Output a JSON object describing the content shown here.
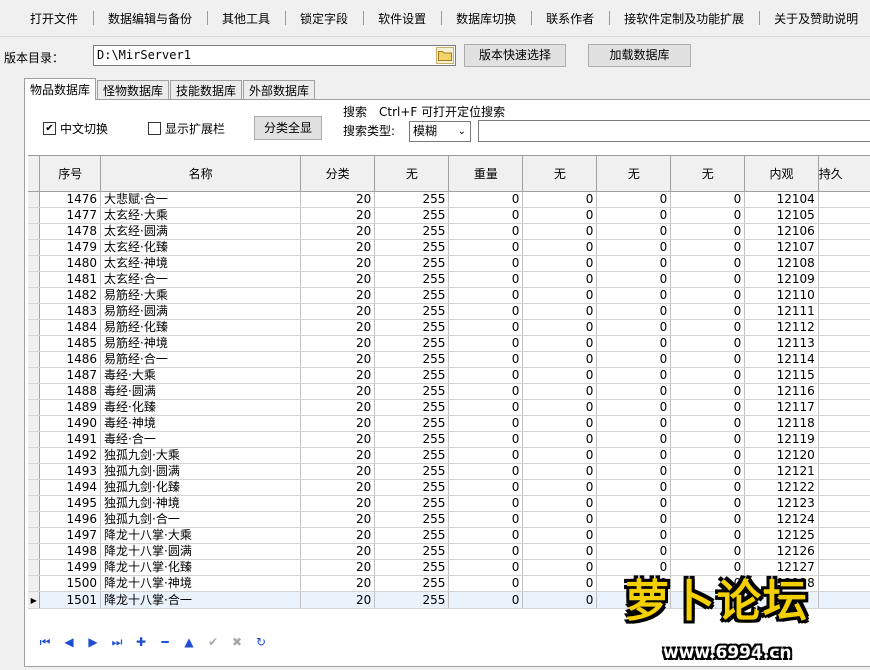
{
  "menu": [
    "打开文件",
    "数据编辑与备份",
    "其他工具",
    "锁定字段",
    "软件设置",
    "数据库切换",
    "联系作者",
    "接软件定制及功能扩展",
    "关于及赞助说明"
  ],
  "version": {
    "label": "版本目录：",
    "path": "D:\\MirServer1",
    "quick_select": "版本快速选择",
    "load_db": "加载数据库"
  },
  "tabs": [
    "物品数据库",
    "怪物数据库",
    "技能数据库",
    "外部数据库"
  ],
  "options": {
    "chinese_switch": "中文切换",
    "chinese_switch_checked": true,
    "show_ext": "显示扩展栏",
    "show_ext_checked": false,
    "show_all_categories": "分类全显"
  },
  "search": {
    "hint": "搜索　Ctrl+F 可打开定位搜索",
    "type_label": "搜索类型:",
    "type_value": "模糊",
    "query": ""
  },
  "grid": {
    "columns": [
      "序号",
      "名称",
      "分类",
      "无",
      "重量",
      "无",
      "无",
      "无",
      "内观",
      "持久"
    ],
    "selected_row": 25,
    "rows": [
      [
        "1476",
        "大悲赋·合一",
        "20",
        "255",
        "0",
        "0",
        "0",
        "0",
        "12104"
      ],
      [
        "1477",
        "太玄经·大乘",
        "20",
        "255",
        "0",
        "0",
        "0",
        "0",
        "12105"
      ],
      [
        "1478",
        "太玄经·圆满",
        "20",
        "255",
        "0",
        "0",
        "0",
        "0",
        "12106"
      ],
      [
        "1479",
        "太玄经·化臻",
        "20",
        "255",
        "0",
        "0",
        "0",
        "0",
        "12107"
      ],
      [
        "1480",
        "太玄经·神境",
        "20",
        "255",
        "0",
        "0",
        "0",
        "0",
        "12108"
      ],
      [
        "1481",
        "太玄经·合一",
        "20",
        "255",
        "0",
        "0",
        "0",
        "0",
        "12109"
      ],
      [
        "1482",
        "易筋经·大乘",
        "20",
        "255",
        "0",
        "0",
        "0",
        "0",
        "12110"
      ],
      [
        "1483",
        "易筋经·圆满",
        "20",
        "255",
        "0",
        "0",
        "0",
        "0",
        "12111"
      ],
      [
        "1484",
        "易筋经·化臻",
        "20",
        "255",
        "0",
        "0",
        "0",
        "0",
        "12112"
      ],
      [
        "1485",
        "易筋经·神境",
        "20",
        "255",
        "0",
        "0",
        "0",
        "0",
        "12113"
      ],
      [
        "1486",
        "易筋经·合一",
        "20",
        "255",
        "0",
        "0",
        "0",
        "0",
        "12114"
      ],
      [
        "1487",
        "毒经·大乘",
        "20",
        "255",
        "0",
        "0",
        "0",
        "0",
        "12115"
      ],
      [
        "1488",
        "毒经·圆满",
        "20",
        "255",
        "0",
        "0",
        "0",
        "0",
        "12116"
      ],
      [
        "1489",
        "毒经·化臻",
        "20",
        "255",
        "0",
        "0",
        "0",
        "0",
        "12117"
      ],
      [
        "1490",
        "毒经·神境",
        "20",
        "255",
        "0",
        "0",
        "0",
        "0",
        "12118"
      ],
      [
        "1491",
        "毒经·合一",
        "20",
        "255",
        "0",
        "0",
        "0",
        "0",
        "12119"
      ],
      [
        "1492",
        "独孤九剑·大乘",
        "20",
        "255",
        "0",
        "0",
        "0",
        "0",
        "12120"
      ],
      [
        "1493",
        "独孤九剑·圆满",
        "20",
        "255",
        "0",
        "0",
        "0",
        "0",
        "12121"
      ],
      [
        "1494",
        "独孤九剑·化臻",
        "20",
        "255",
        "0",
        "0",
        "0",
        "0",
        "12122"
      ],
      [
        "1495",
        "独孤九剑·神境",
        "20",
        "255",
        "0",
        "0",
        "0",
        "0",
        "12123"
      ],
      [
        "1496",
        "独孤九剑·合一",
        "20",
        "255",
        "0",
        "0",
        "0",
        "0",
        "12124"
      ],
      [
        "1497",
        "降龙十八掌·大乘",
        "20",
        "255",
        "0",
        "0",
        "0",
        "0",
        "12125"
      ],
      [
        "1498",
        "降龙十八掌·圆满",
        "20",
        "255",
        "0",
        "0",
        "0",
        "0",
        "12126"
      ],
      [
        "1499",
        "降龙十八掌·化臻",
        "20",
        "255",
        "0",
        "0",
        "0",
        "0",
        "12127"
      ],
      [
        "1500",
        "降龙十八掌·神境",
        "20",
        "255",
        "0",
        "0",
        "0",
        "0",
        "12128"
      ],
      [
        "1501",
        "降龙十八掌·合一",
        "20",
        "255",
        "0",
        "0",
        "0",
        "0",
        ""
      ]
    ]
  },
  "navigator": [
    {
      "name": "first-record-icon",
      "glyph": "⏮",
      "enabled": true
    },
    {
      "name": "prior-record-icon",
      "glyph": "◀",
      "enabled": true
    },
    {
      "name": "next-record-icon",
      "glyph": "▶",
      "enabled": true
    },
    {
      "name": "last-record-icon",
      "glyph": "⏭",
      "enabled": true
    },
    {
      "name": "insert-record-icon",
      "glyph": "✚",
      "enabled": true
    },
    {
      "name": "delete-record-icon",
      "glyph": "━",
      "enabled": true
    },
    {
      "name": "edit-record-icon",
      "glyph": "▲",
      "enabled": true
    },
    {
      "name": "post-record-icon",
      "glyph": "✔",
      "enabled": false
    },
    {
      "name": "cancel-edit-icon",
      "glyph": "✖",
      "enabled": false
    },
    {
      "name": "refresh-icon",
      "glyph": "↻",
      "enabled": true
    }
  ],
  "watermark": {
    "logo": "萝卜论坛",
    "url": "www.6994.cn"
  }
}
